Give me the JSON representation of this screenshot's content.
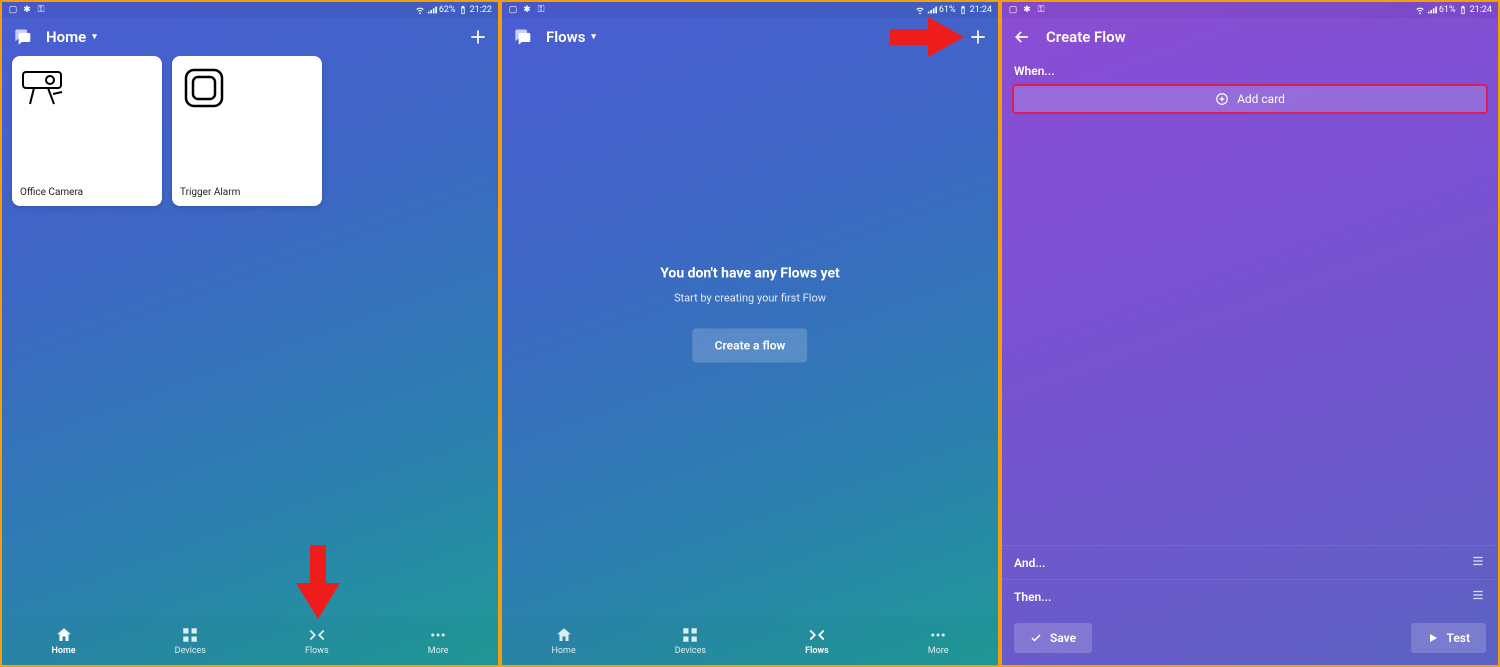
{
  "statusbar": {
    "a": {
      "battery": "62%",
      "time": "21:22"
    },
    "b": {
      "battery": "61%",
      "time": "21:24"
    },
    "c": {
      "battery": "61%",
      "time": "21:24"
    }
  },
  "screens": {
    "a": {
      "header_title": "Home",
      "devices": [
        {
          "name": "Office Camera",
          "icon": "camera"
        },
        {
          "name": "Trigger Alarm",
          "icon": "button"
        }
      ]
    },
    "b": {
      "header_title": "Flows",
      "empty_title": "You don't have any Flows yet",
      "empty_sub": "Start by creating your first Flow",
      "empty_button": "Create a flow"
    },
    "c": {
      "header_title": "Create Flow",
      "when_label": "When...",
      "addcard_label": "Add card",
      "and_label": "And...",
      "then_label": "Then...",
      "save_label": "Save",
      "test_label": "Test"
    }
  },
  "nav": {
    "home": "Home",
    "devices": "Devices",
    "flows": "Flows",
    "more": "More"
  }
}
